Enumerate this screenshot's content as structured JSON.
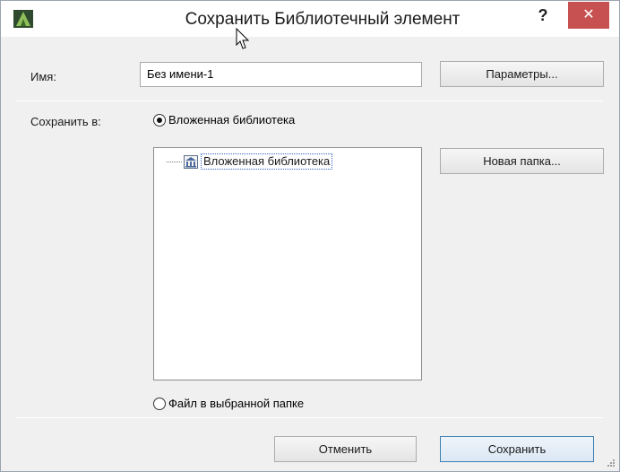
{
  "window": {
    "title": "Сохранить Библиотечный элемент",
    "help_label": "?",
    "close_label": "✕",
    "title_bg": "#ffffff",
    "close_color": "#c75050"
  },
  "name_field": {
    "label": "Имя:",
    "value": "Без имени-1"
  },
  "params_button": "Параметры...",
  "save_in": {
    "label": "Сохранить в:",
    "option_embedded": "Вложенная библиотека",
    "option_file": "Файл в выбранной папке",
    "selected": "embedded"
  },
  "tree": {
    "items": [
      {
        "label": "Вложенная библиотека",
        "icon": "library-icon"
      }
    ]
  },
  "new_folder_button": "Новая папка...",
  "footer": {
    "cancel_label": "Отменить",
    "save_label": "Сохранить"
  }
}
